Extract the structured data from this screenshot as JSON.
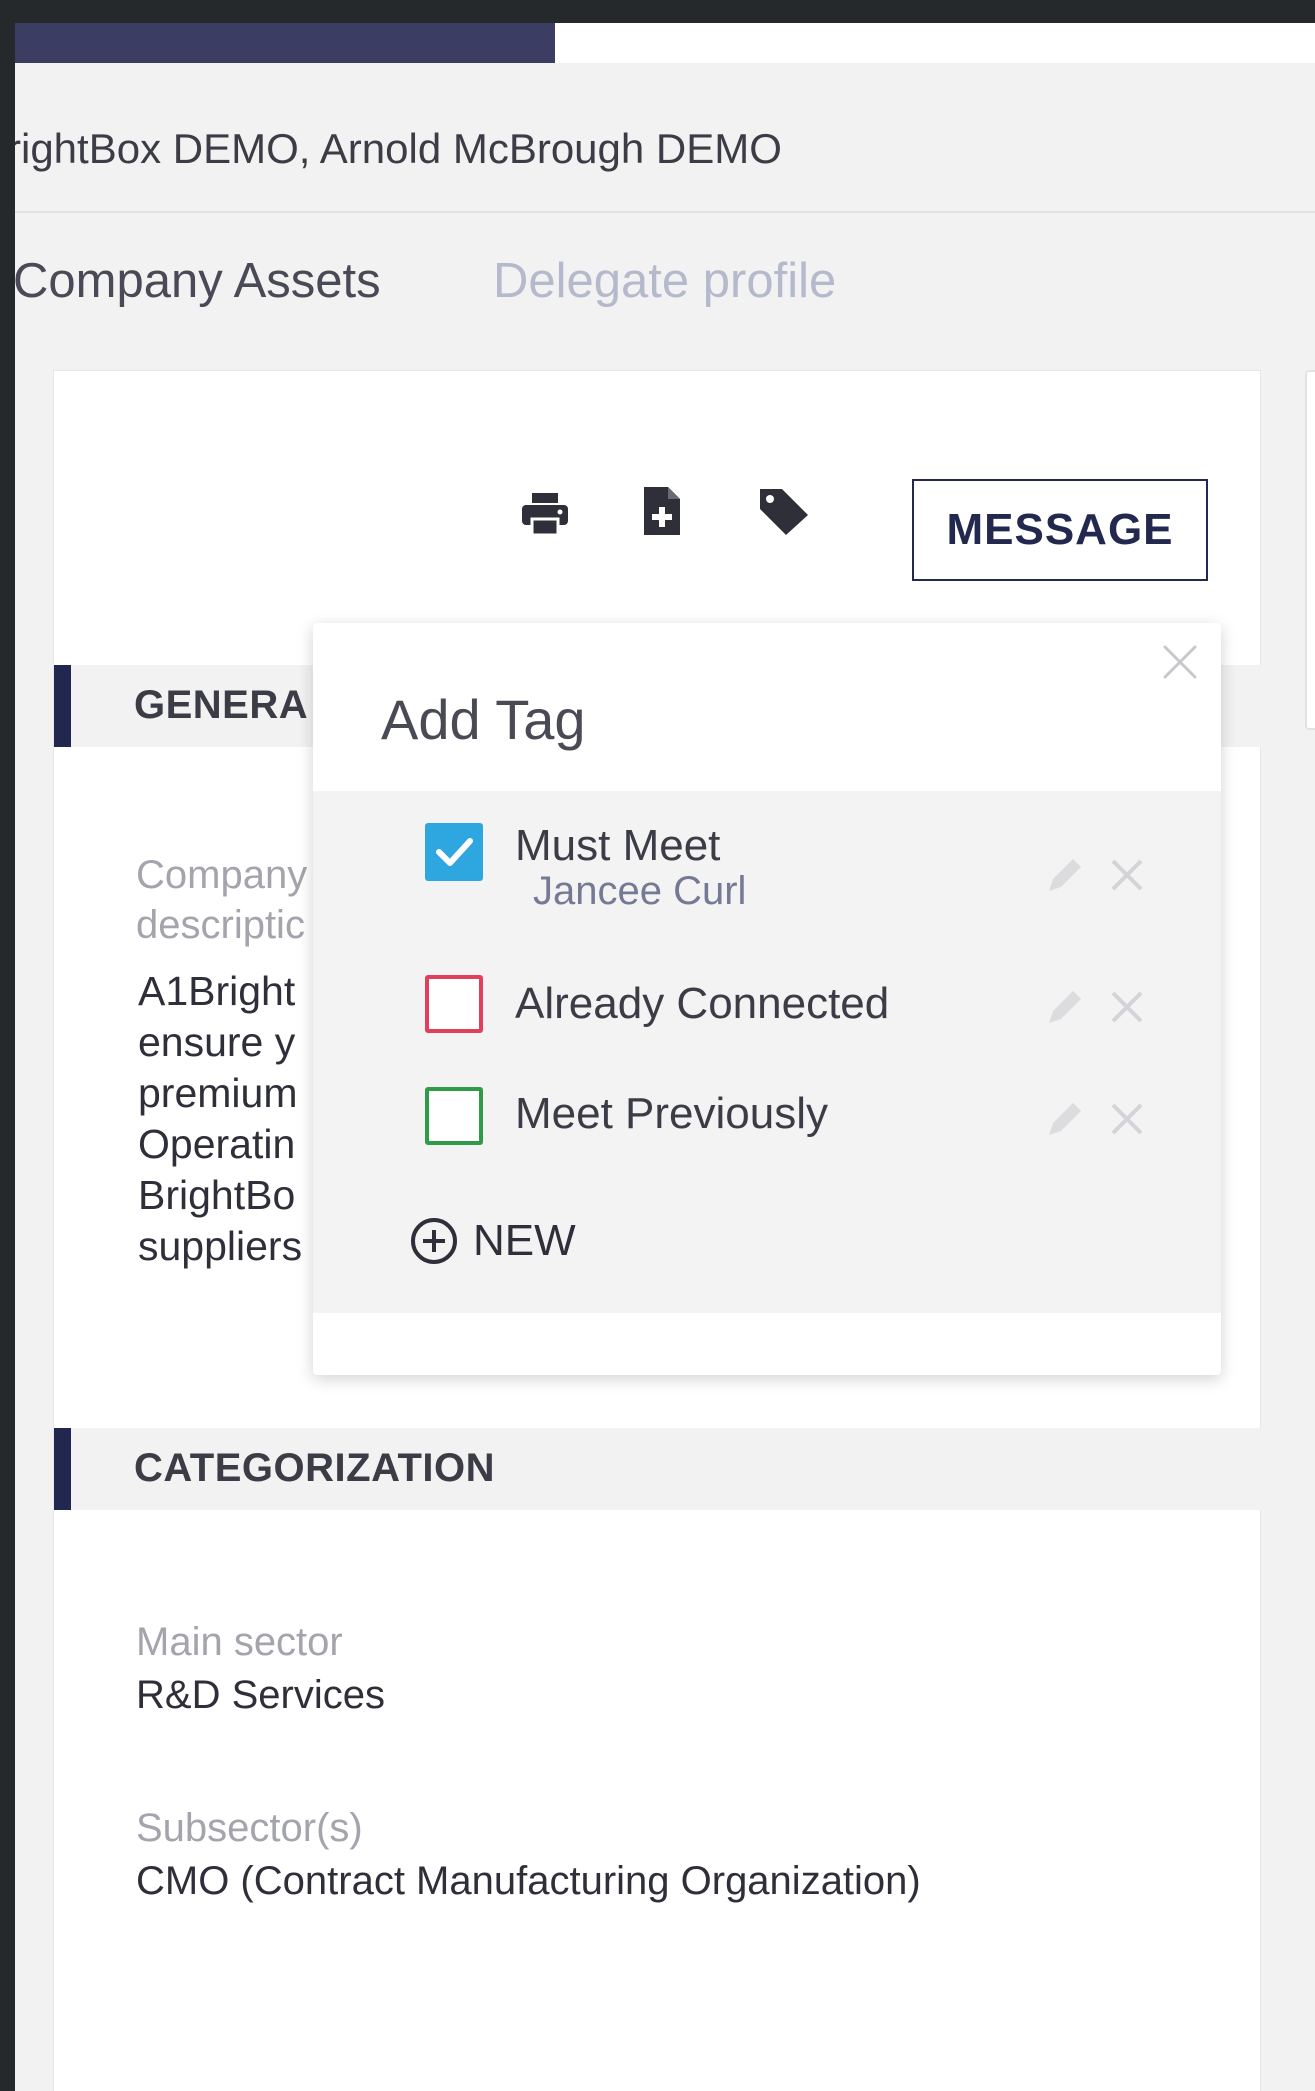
{
  "breadcrumb": "rightBox DEMO, Arnold McBrough DEMO",
  "tabs": [
    {
      "label": "Company Assets"
    },
    {
      "label": "Delegate profile"
    }
  ],
  "toolbar": {
    "print_icon": "printer-icon",
    "export_icon": "file-add-icon",
    "tag_icon": "tag-icon",
    "message_label": "MESSAGE"
  },
  "general": {
    "title": "GENERA",
    "company_label_1": "Company",
    "company_label_2": "descriptic",
    "description_lines": [
      "A1Bright",
      "ensure y",
      "premium",
      "Operatin",
      "BrightBo",
      "suppliers"
    ]
  },
  "categorization": {
    "title": "CATEGORIZATION",
    "main_sector_label": "Main sector",
    "main_sector_value": "R&D Services",
    "subsector_label": "Subsector(s)",
    "subsector_value": "CMO (Contract Manufacturing Organization)"
  },
  "add_tag": {
    "title": "Add Tag",
    "tags": [
      {
        "name": "Must Meet",
        "sub": "Jancee Curl",
        "checked": true,
        "color": "#2ea7e0"
      },
      {
        "name": "Already Connected",
        "sub": "",
        "checked": false,
        "color": "#e0405b"
      },
      {
        "name": "Meet Previously",
        "sub": "",
        "checked": false,
        "color": "#2f9a47"
      }
    ],
    "new_label": "NEW"
  },
  "colors": {
    "accent": "#22274f",
    "banner": "#3b3d63"
  }
}
